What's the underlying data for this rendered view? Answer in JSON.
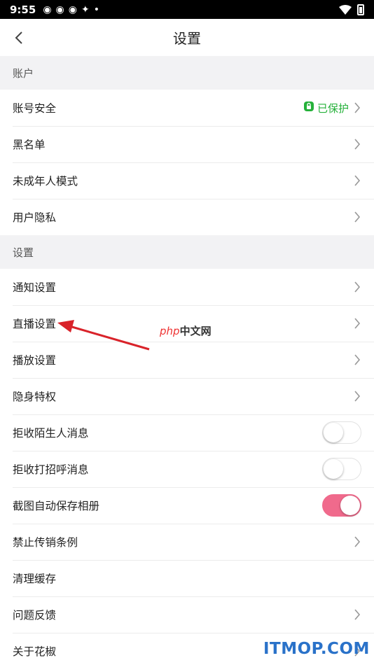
{
  "status_bar": {
    "time": "9:55"
  },
  "nav": {
    "title": "设置"
  },
  "sections": [
    {
      "header": "账户",
      "rows": [
        {
          "label": "账号安全",
          "status": "已保护",
          "status_color": "#25b13a",
          "chevron": true
        },
        {
          "label": "黑名单",
          "chevron": true
        },
        {
          "label": "未成年人模式",
          "chevron": true
        },
        {
          "label": "用户隐私",
          "chevron": true
        }
      ]
    },
    {
      "header": "设置",
      "rows": [
        {
          "label": "通知设置",
          "chevron": true
        },
        {
          "label": "直播设置",
          "chevron": true
        },
        {
          "label": "播放设置",
          "chevron": true
        },
        {
          "label": "隐身特权",
          "chevron": true
        },
        {
          "label": "拒收陌生人消息",
          "toggle": false
        },
        {
          "label": "拒收打招呼消息",
          "toggle": false
        },
        {
          "label": "截图自动保存相册",
          "toggle": true
        },
        {
          "label": "禁止传销条例",
          "chevron": true
        },
        {
          "label": "清理缓存",
          "chevron": false
        },
        {
          "label": "问题反馈",
          "chevron": true
        },
        {
          "label": "关于花椒",
          "chevron": true
        }
      ]
    }
  ],
  "overlay": {
    "php_logo": "php",
    "php_logo_cn": "中文网",
    "watermark": "ITMOP.COM"
  },
  "colors": {
    "toggle_on": "#f06a8c",
    "protected_green": "#25b13a",
    "arrow_red": "#d9232a"
  }
}
